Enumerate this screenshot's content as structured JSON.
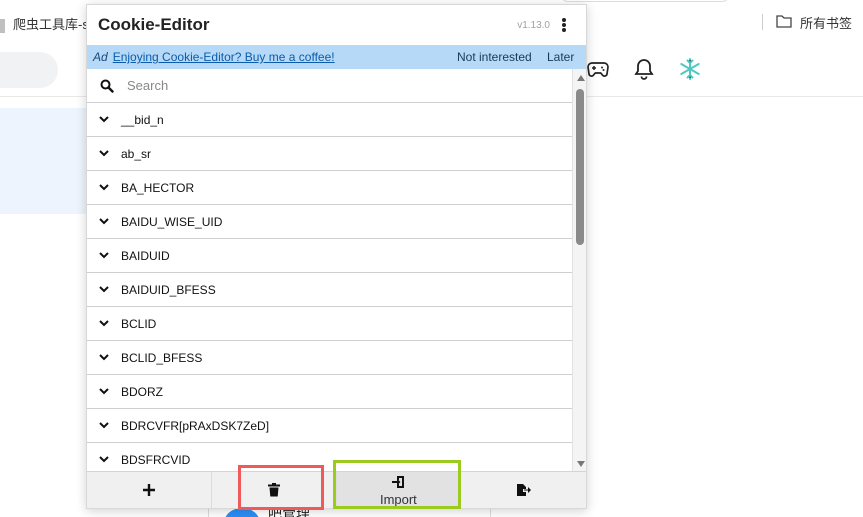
{
  "browser": {
    "bookmark_left": "爬虫工具库-s",
    "bookmark_right": "所有书签",
    "bottom_text": "吧管理"
  },
  "popup": {
    "title": "Cookie-Editor",
    "version": "v1.13.0",
    "ad": {
      "tag": "Ad",
      "link": "Enjoying Cookie-Editor? Buy me a coffee!",
      "not_interested": "Not interested",
      "later": "Later"
    },
    "search": {
      "placeholder": "Search",
      "value": ""
    },
    "cookies": [
      "__bid_n",
      "ab_sr",
      "BA_HECTOR",
      "BAIDU_WISE_UID",
      "BAIDUID",
      "BAIDUID_BFESS",
      "BCLID",
      "BCLID_BFESS",
      "BDORZ",
      "BDRCVFR[pRAxDSK7ZeD]",
      "BDSFRCVID"
    ],
    "footer": {
      "add_icon": "plus-icon",
      "delete_icon": "trash-icon",
      "import_label": "Import",
      "import_icon": "import-icon",
      "export_icon": "export-icon"
    }
  },
  "colors": {
    "ad_bar": "#b6d9f7",
    "highlight_red": "#ee5a5a",
    "highlight_green": "#9ccb1f"
  }
}
